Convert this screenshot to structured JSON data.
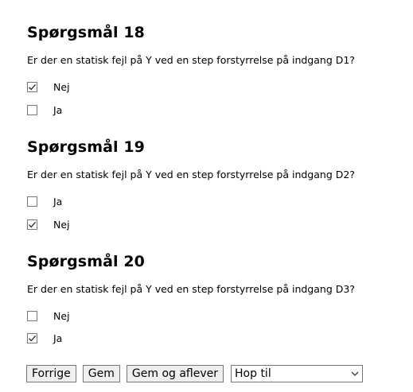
{
  "questions": [
    {
      "title": "Spørgsmål 18",
      "text": "Er der en statisk fejl på Y ved en step forstyrrelse på indgang D1?",
      "options": [
        {
          "label": "Nej",
          "checked": true
        },
        {
          "label": "Ja",
          "checked": false
        }
      ]
    },
    {
      "title": "Spørgsmål 19",
      "text": "Er der en statisk fejl på Y ved en step forstyrrelse på indgang D2?",
      "options": [
        {
          "label": "Ja",
          "checked": false
        },
        {
          "label": "Nej",
          "checked": true
        }
      ]
    },
    {
      "title": "Spørgsmål 20",
      "text": "Er der en statisk fejl på Y ved en step forstyrrelse på indgang D3?",
      "options": [
        {
          "label": "Nej",
          "checked": false
        },
        {
          "label": "Ja",
          "checked": true
        }
      ]
    }
  ],
  "buttons": {
    "previous": "Forrige",
    "save": "Gem",
    "save_submit": "Gem og aflever"
  },
  "jump_select": {
    "selected": "Hop til"
  },
  "icons": {
    "checkmark": "checkmark-icon",
    "dropdown": "chevron-down-icon"
  },
  "colors": {
    "border": "#767676",
    "button_bg": "#efefef"
  }
}
